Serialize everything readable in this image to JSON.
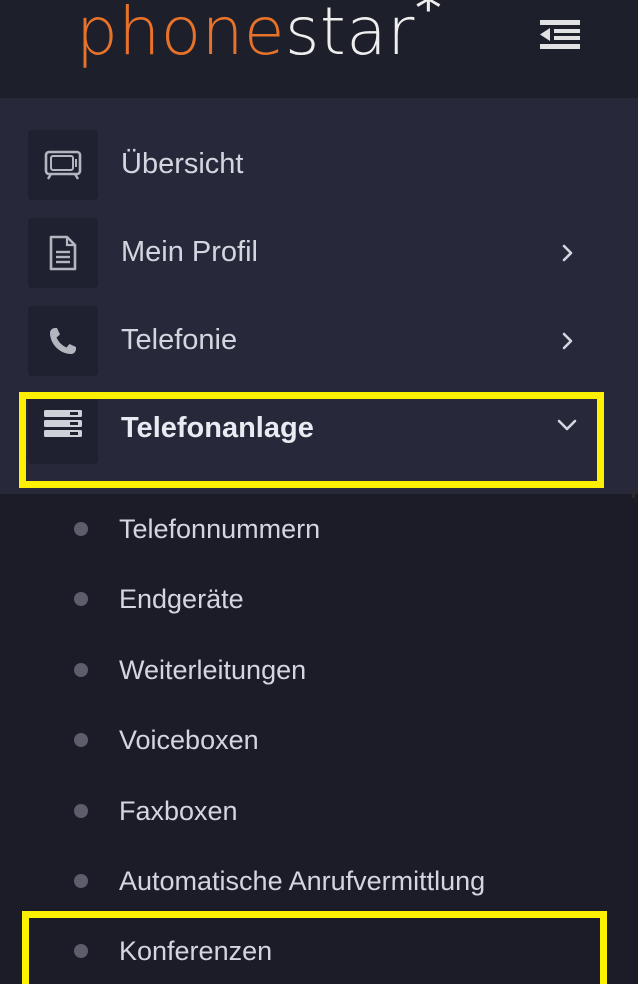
{
  "brand": {
    "logo_part1": "phone",
    "logo_part2": "star",
    "logo_mark": "*",
    "colors": {
      "phone": "#e8722a",
      "star": "#eeeeee"
    }
  },
  "header": {
    "toggle_icon": "sidebar-collapse-icon"
  },
  "menu": {
    "items": [
      {
        "label": "Übersicht",
        "icon": "monitor-icon"
      },
      {
        "label": "Mein Profil",
        "icon": "document-icon"
      },
      {
        "label": "Telefonie",
        "icon": "phone-icon"
      },
      {
        "label": "Telefonanlage",
        "icon": "server-icon",
        "expanded": true
      }
    ]
  },
  "submenu": {
    "items": [
      {
        "label": "Telefonnummern"
      },
      {
        "label": "Endgeräte"
      },
      {
        "label": "Weiterleitungen"
      },
      {
        "label": "Voiceboxen"
      },
      {
        "label": "Faxboxen"
      },
      {
        "label": "Automatische Anrufvermittlung"
      },
      {
        "label": "Konferenzen"
      }
    ]
  },
  "highlight_color": "#fdf000"
}
